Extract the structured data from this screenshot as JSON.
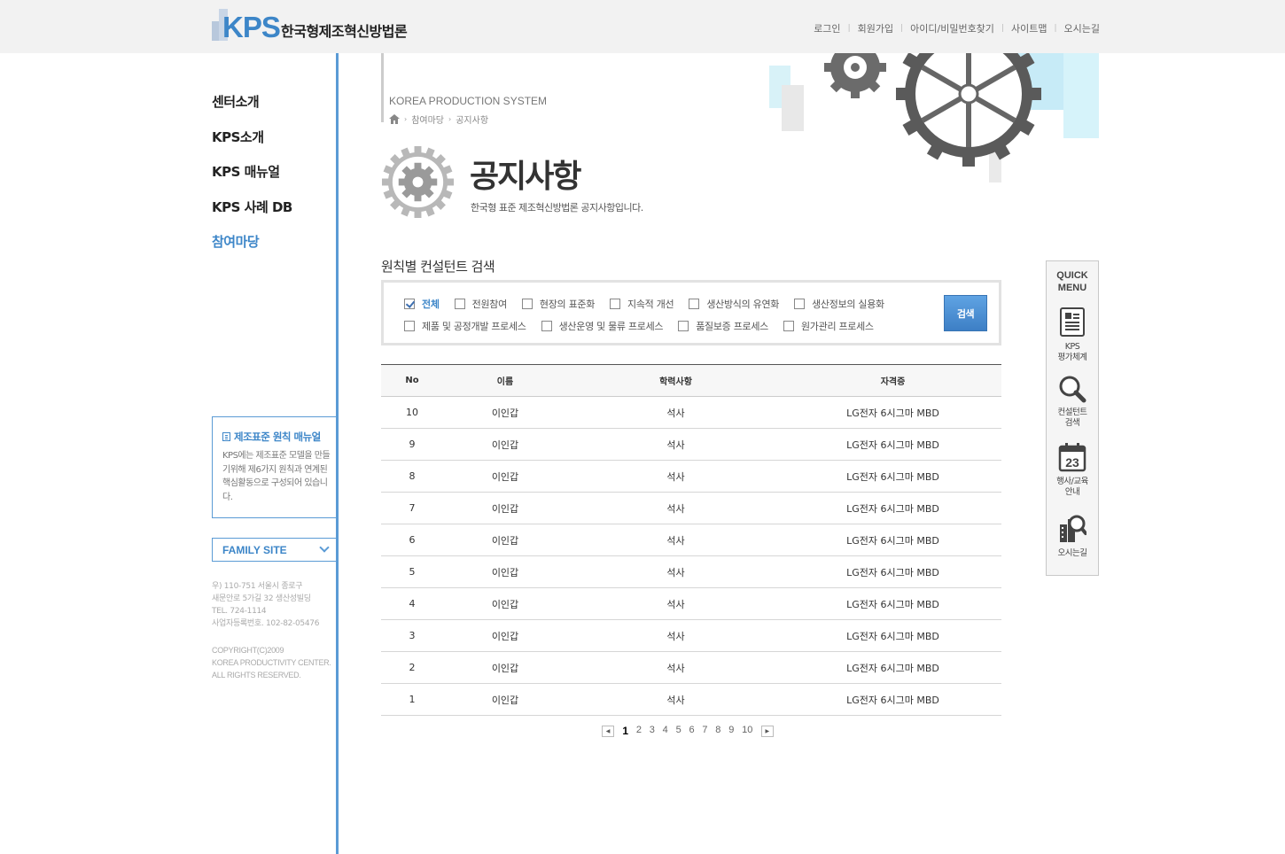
{
  "header": {
    "logo_text": "KPS",
    "site_title": "한국형제조혁신방법론",
    "nav": [
      "로그인",
      "회원가입",
      "아이디/비밀번호찾기",
      "사이트맵",
      "오시는길"
    ]
  },
  "sidebar": {
    "items": [
      {
        "label": "센터소개",
        "active": false
      },
      {
        "label": "KPS소개",
        "active": false
      },
      {
        "label": "KPS 매뉴얼",
        "active": false
      },
      {
        "label": "KPS 사례 DB",
        "active": false
      },
      {
        "label": "참여마당",
        "active": true
      }
    ],
    "manual_box": {
      "title": "제조표준 원칙 매뉴얼",
      "desc": "KPS에는 제조표준 모델을 만들기위해 제6가지 원칙과 연계된 핵심활동으로 구성되어 있습니다."
    },
    "family_site": "FAMILY SITE",
    "address": [
      "우) 110-751 서울시 종로구",
      "새문안로 5가길 32 생산성빌딩",
      "TEL. 724-1114",
      "사업자등록번호. 102-82-05476"
    ],
    "copyright": [
      "COPYRIGHT(C)2009",
      "KOREA PRODUCTIVITY CENTER.",
      "ALL RIGHTS RESERVED."
    ]
  },
  "banner": {
    "system_name": "KOREA PRODUCTION SYSTEM",
    "breadcrumb": [
      "참여마당",
      "공지사항"
    ]
  },
  "page": {
    "title": "공지사항",
    "subtitle": "한국형 표준 제조혁신방법론 공지사항입니다."
  },
  "search": {
    "section_title": "원칙별 컨설턴트 검색",
    "row1": [
      {
        "label": "전체",
        "checked": true
      },
      {
        "label": "전원참여",
        "checked": false
      },
      {
        "label": "현장의 표준화",
        "checked": false
      },
      {
        "label": "지속적 개선",
        "checked": false
      },
      {
        "label": "생산방식의 유연화",
        "checked": false
      },
      {
        "label": "생산정보의 실용화",
        "checked": false
      }
    ],
    "row2": [
      {
        "label": "제품 및 공정개발 프로세스",
        "checked": false
      },
      {
        "label": "생산운영 및 물류 프로세스",
        "checked": false
      },
      {
        "label": "품질보증 프로세스",
        "checked": false
      },
      {
        "label": "원가관리 프로세스",
        "checked": false
      }
    ],
    "button_label": "검색"
  },
  "table": {
    "headers": [
      "No",
      "이름",
      "학력사항",
      "자격증"
    ],
    "rows": [
      [
        "10",
        "이인갑",
        "석사",
        "LG전자 6시그마 MBD"
      ],
      [
        "9",
        "이인갑",
        "석사",
        "LG전자 6시그마 MBD"
      ],
      [
        "8",
        "이인갑",
        "석사",
        "LG전자 6시그마 MBD"
      ],
      [
        "7",
        "이인갑",
        "석사",
        "LG전자 6시그마 MBD"
      ],
      [
        "6",
        "이인갑",
        "석사",
        "LG전자 6시그마 MBD"
      ],
      [
        "5",
        "이인갑",
        "석사",
        "LG전자 6시그마 MBD"
      ],
      [
        "4",
        "이인갑",
        "석사",
        "LG전자 6시그마 MBD"
      ],
      [
        "3",
        "이인갑",
        "석사",
        "LG전자 6시그마 MBD"
      ],
      [
        "2",
        "이인갑",
        "석사",
        "LG전자 6시그마 MBD"
      ],
      [
        "1",
        "이인갑",
        "석사",
        "LG전자 6시그마 MBD"
      ]
    ]
  },
  "pagination": {
    "pages": [
      "1",
      "2",
      "3",
      "4",
      "5",
      "6",
      "7",
      "8",
      "9",
      "10"
    ],
    "current": "1"
  },
  "quick_menu": {
    "title_line1": "QUICK",
    "title_line2": "MENU",
    "items": [
      {
        "icon": "document-icon",
        "line1": "KPS",
        "line2": "평가체계"
      },
      {
        "icon": "search-icon",
        "line1": "컨설턴트",
        "line2": "검색"
      },
      {
        "icon": "calendar-icon",
        "line1": "행사/교육",
        "line2": "안내",
        "day": "23"
      },
      {
        "icon": "map-search-icon",
        "line1": "오시는길",
        "line2": ""
      }
    ]
  },
  "colors": {
    "accent": "#3d86c8",
    "sidebar_line": "#5b9bd5",
    "button": "#4a8fd6"
  }
}
